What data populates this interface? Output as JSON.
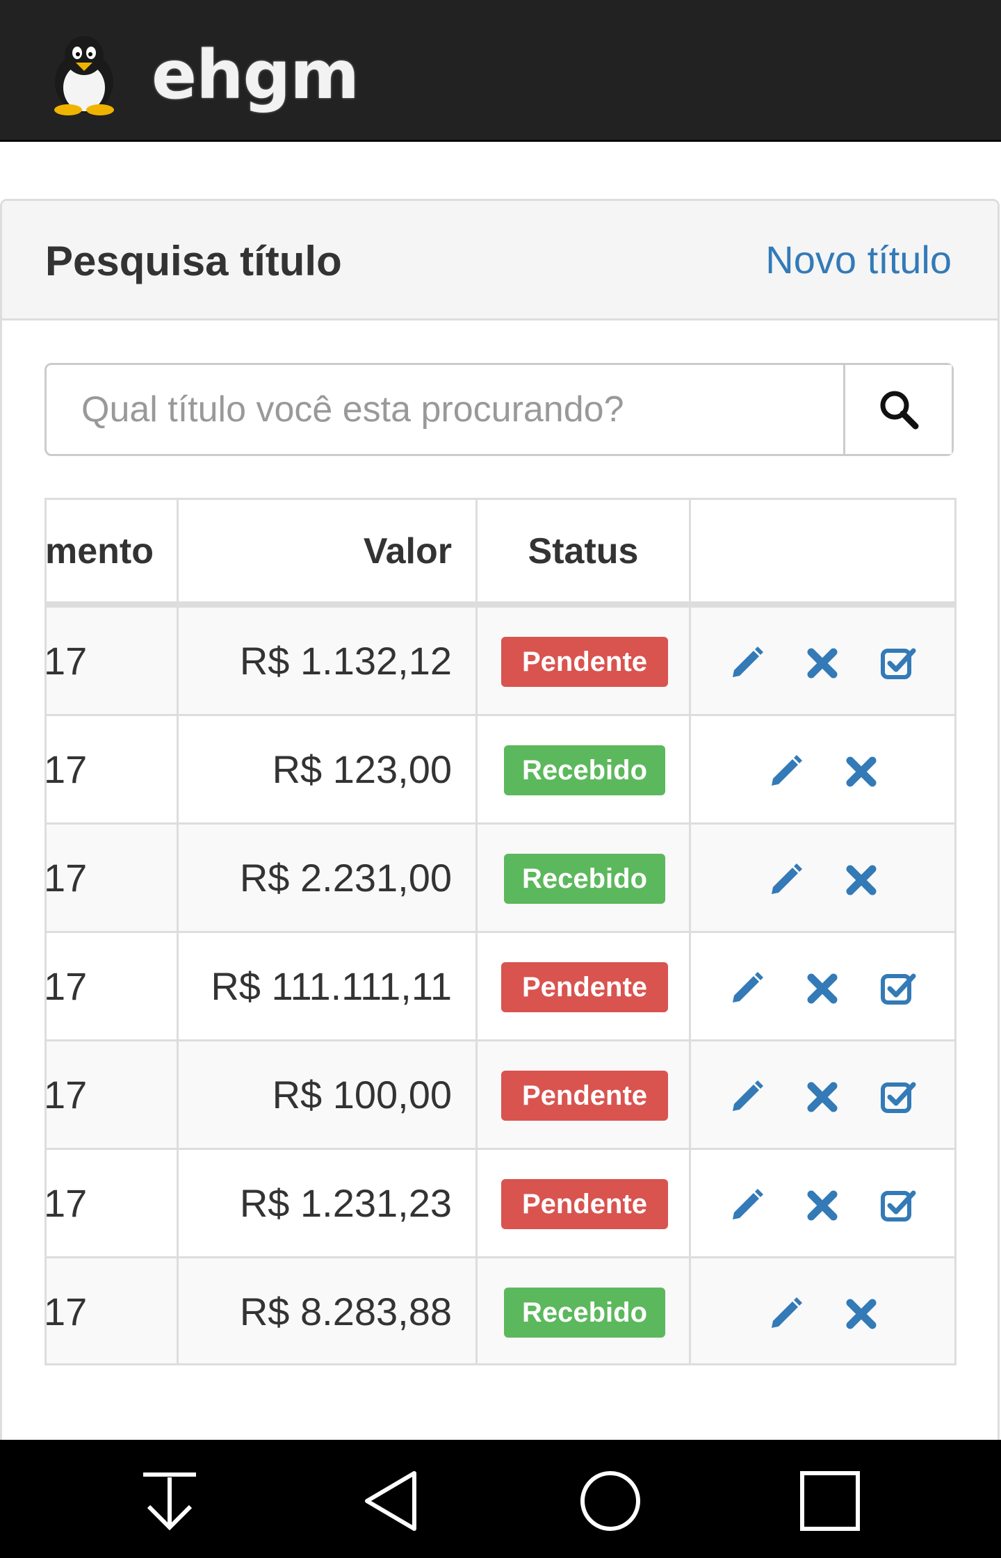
{
  "header": {
    "app_name": "ehgm",
    "logo_icon": "penguin-icon"
  },
  "panel": {
    "title": "Pesquisa título",
    "new_link": "Novo título"
  },
  "search": {
    "placeholder": "Qual título você esta procurando?",
    "button_icon": "search-icon"
  },
  "table": {
    "columns": [
      "mento",
      "Valor",
      "Status",
      ""
    ],
    "rows": [
      {
        "date_fragment": "17",
        "valor": "R$ 1.132,12",
        "status": "Pendente",
        "actions": [
          "edit",
          "delete",
          "receive"
        ]
      },
      {
        "date_fragment": "17",
        "valor": "R$ 123,00",
        "status": "Recebido",
        "actions": [
          "edit",
          "delete"
        ]
      },
      {
        "date_fragment": "17",
        "valor": "R$ 2.231,00",
        "status": "Recebido",
        "actions": [
          "edit",
          "delete"
        ]
      },
      {
        "date_fragment": "17",
        "valor": "R$ 111.111,11",
        "status": "Pendente",
        "actions": [
          "edit",
          "delete",
          "receive"
        ]
      },
      {
        "date_fragment": "17",
        "valor": "R$ 100,00",
        "status": "Pendente",
        "actions": [
          "edit",
          "delete",
          "receive"
        ]
      },
      {
        "date_fragment": "17",
        "valor": "R$ 1.231,23",
        "status": "Pendente",
        "actions": [
          "edit",
          "delete",
          "receive"
        ]
      },
      {
        "date_fragment": "17",
        "valor": "R$ 8.283,88",
        "status": "Recebido",
        "actions": [
          "edit",
          "delete"
        ]
      }
    ]
  },
  "colors": {
    "pending": "#d9534f",
    "received": "#5cb85c",
    "link": "#337ab7",
    "topbar": "#222222"
  },
  "system_nav": [
    "download-arrow-icon",
    "back-icon",
    "home-icon",
    "recents-icon"
  ]
}
